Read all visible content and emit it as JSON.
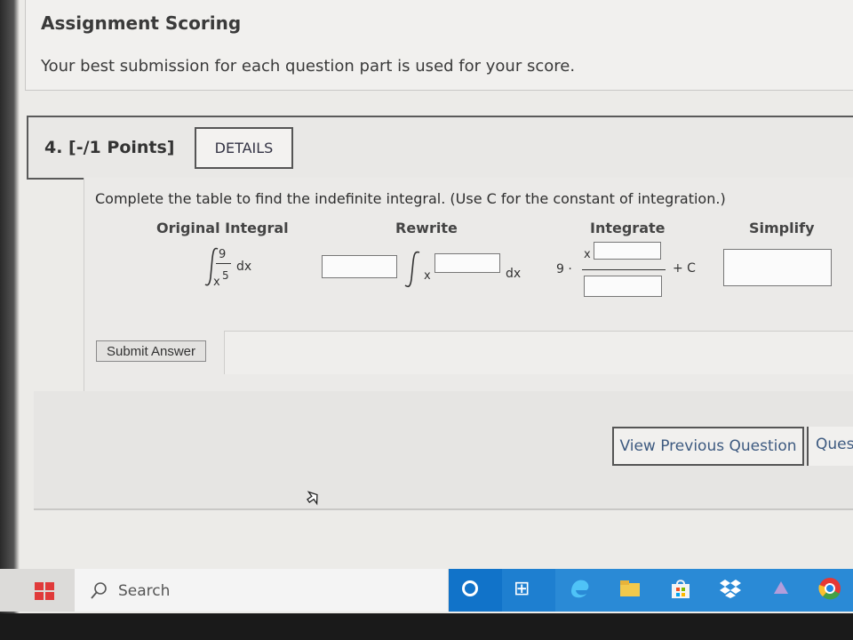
{
  "scoring": {
    "title": "Assignment Scoring",
    "text": "Your best submission for each question part is used for your score."
  },
  "question": {
    "number_label": "4. [-/1 Points]",
    "details_label": "DETAILS",
    "instruction": "Complete the table to find the indefinite integral. (Use C for the constant of integration.)",
    "columns": [
      "Original Integral",
      "Rewrite",
      "Integrate",
      "Simplify"
    ],
    "original": {
      "numerator": "9",
      "denominator_base": "x",
      "denominator_exp": "5",
      "dx": "dx"
    },
    "rewrite": {
      "var": "x",
      "dx": "dx"
    },
    "integrate": {
      "coefficient": "9 ·",
      "var": "x",
      "constant": "+ C"
    },
    "submit_label": "Submit Answer"
  },
  "nav": {
    "view_previous_label": "View Previous Question",
    "next_label": "Ques"
  },
  "taskbar": {
    "search_label": "Search"
  }
}
